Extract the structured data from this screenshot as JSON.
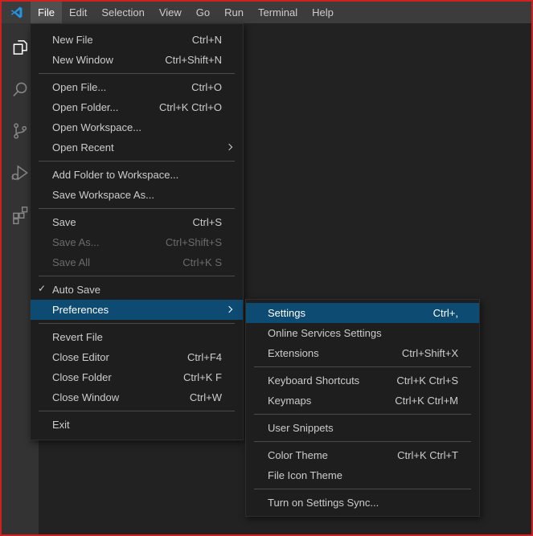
{
  "colors": {
    "selection_blue": "#0e4b73",
    "window_border_red": "#cf2121",
    "menubar_bg": "#3c3c3c",
    "activitybar_bg": "#333333",
    "menu_bg": "#1e1e1f"
  },
  "menubar": {
    "items": [
      {
        "label": "File"
      },
      {
        "label": "Edit"
      },
      {
        "label": "Selection"
      },
      {
        "label": "View"
      },
      {
        "label": "Go"
      },
      {
        "label": "Run"
      },
      {
        "label": "Terminal"
      },
      {
        "label": "Help"
      }
    ],
    "active_item": "File"
  },
  "activity_bar": {
    "icons": [
      {
        "name": "explorer",
        "active": true
      },
      {
        "name": "search",
        "active": false
      },
      {
        "name": "source-control",
        "active": false
      },
      {
        "name": "run-and-debug",
        "active": false
      },
      {
        "name": "extensions",
        "active": false
      }
    ]
  },
  "file_menu": {
    "items": [
      {
        "label": "New File",
        "shortcut": "Ctrl+N"
      },
      {
        "label": "New Window",
        "shortcut": "Ctrl+Shift+N"
      },
      {
        "label": "Open File...",
        "shortcut": "Ctrl+O"
      },
      {
        "label": "Open Folder...",
        "shortcut": "Ctrl+K Ctrl+O"
      },
      {
        "label": "Open Workspace..."
      },
      {
        "label": "Open Recent",
        "has_submenu": true
      },
      {
        "label": "Add Folder to Workspace..."
      },
      {
        "label": "Save Workspace As..."
      },
      {
        "label": "Save",
        "shortcut": "Ctrl+S"
      },
      {
        "label": "Save As...",
        "shortcut": "Ctrl+Shift+S",
        "disabled": true
      },
      {
        "label": "Save All",
        "shortcut": "Ctrl+K S",
        "disabled": true
      },
      {
        "label": "Auto Save",
        "checked": true,
        "checkmark": "✓"
      },
      {
        "label": "Preferences",
        "has_submenu": true,
        "selected": true
      },
      {
        "label": "Revert File"
      },
      {
        "label": "Close Editor",
        "shortcut": "Ctrl+F4"
      },
      {
        "label": "Close Folder",
        "shortcut": "Ctrl+K F"
      },
      {
        "label": "Close Window",
        "shortcut": "Ctrl+W"
      },
      {
        "label": "Exit"
      }
    ]
  },
  "preferences_submenu": {
    "items": [
      {
        "label": "Settings",
        "shortcut": "Ctrl+,",
        "selected": true
      },
      {
        "label": "Online Services Settings"
      },
      {
        "label": "Extensions",
        "shortcut": "Ctrl+Shift+X"
      },
      {
        "label": "Keyboard Shortcuts",
        "shortcut": "Ctrl+K Ctrl+S"
      },
      {
        "label": "Keymaps",
        "shortcut": "Ctrl+K Ctrl+M"
      },
      {
        "label": "User Snippets"
      },
      {
        "label": "Color Theme",
        "shortcut": "Ctrl+K Ctrl+T"
      },
      {
        "label": "File Icon Theme"
      },
      {
        "label": "Turn on Settings Sync..."
      }
    ]
  }
}
